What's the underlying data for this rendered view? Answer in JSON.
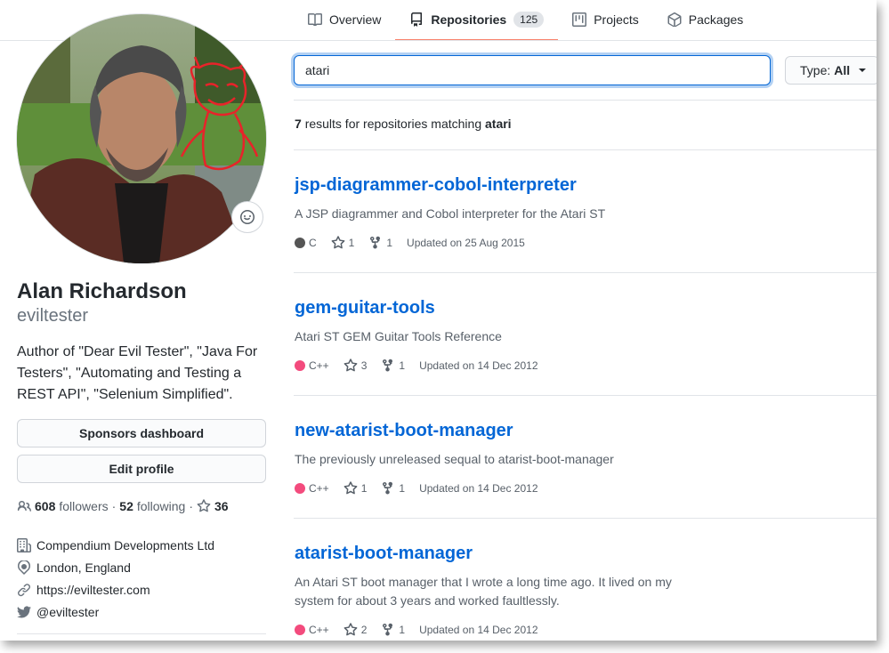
{
  "tabs": [
    {
      "label": "Overview",
      "icon": "book-icon"
    },
    {
      "label": "Repositories",
      "icon": "repo-icon",
      "count": "125",
      "selected": true
    },
    {
      "label": "Projects",
      "icon": "project-icon"
    },
    {
      "label": "Packages",
      "icon": "package-icon"
    }
  ],
  "profile": {
    "fullname": "Alan Richardson",
    "login": "eviltester",
    "bio": "Author of \"Dear Evil Tester\", \"Java For Testers\", \"Automating and Testing a REST API\", \"Selenium Simplified\".",
    "sponsors_button": "Sponsors dashboard",
    "edit_button": "Edit profile",
    "followers_count": "608",
    "followers_label": "followers",
    "following_count": "52",
    "following_label": "following",
    "stars_count": "36",
    "separator": "·",
    "company": "Compendium Developments Ltd",
    "location": "London, England",
    "website": "https://eviltester.com",
    "twitter": "@eviltester"
  },
  "search": {
    "value": "atari",
    "type_label": "Type:",
    "type_value": "All"
  },
  "results": {
    "count": "7",
    "text": "results for repositories matching",
    "query": "atari"
  },
  "repos": [
    {
      "name": "jsp-diagrammer-cobol-interpreter",
      "description": "A JSP diagrammer and Cobol interpreter for the Atari ST",
      "language": "C",
      "lang_color": "#555555",
      "stars": "1",
      "forks": "1",
      "updated": "Updated on 25 Aug 2015"
    },
    {
      "name": "gem-guitar-tools",
      "description": "Atari ST GEM Guitar Tools Reference",
      "language": "C++",
      "lang_color": "#f34b7d",
      "stars": "3",
      "forks": "1",
      "updated": "Updated on 14 Dec 2012"
    },
    {
      "name": "new-atarist-boot-manager",
      "description": "The previously unreleased sequal to atarist-boot-manager",
      "language": "C++",
      "lang_color": "#f34b7d",
      "stars": "1",
      "forks": "1",
      "updated": "Updated on 14 Dec 2012"
    },
    {
      "name": "atarist-boot-manager",
      "description": "An Atari ST boot manager that I wrote a long time ago. It lived on my system for about 3 years and worked faultlessly.",
      "language": "C++",
      "lang_color": "#f34b7d",
      "stars": "2",
      "forks": "1",
      "updated": "Updated on 14 Dec 2012"
    }
  ],
  "colors": {
    "accent": "#0366d6",
    "tab_underline": "#f9826c"
  }
}
